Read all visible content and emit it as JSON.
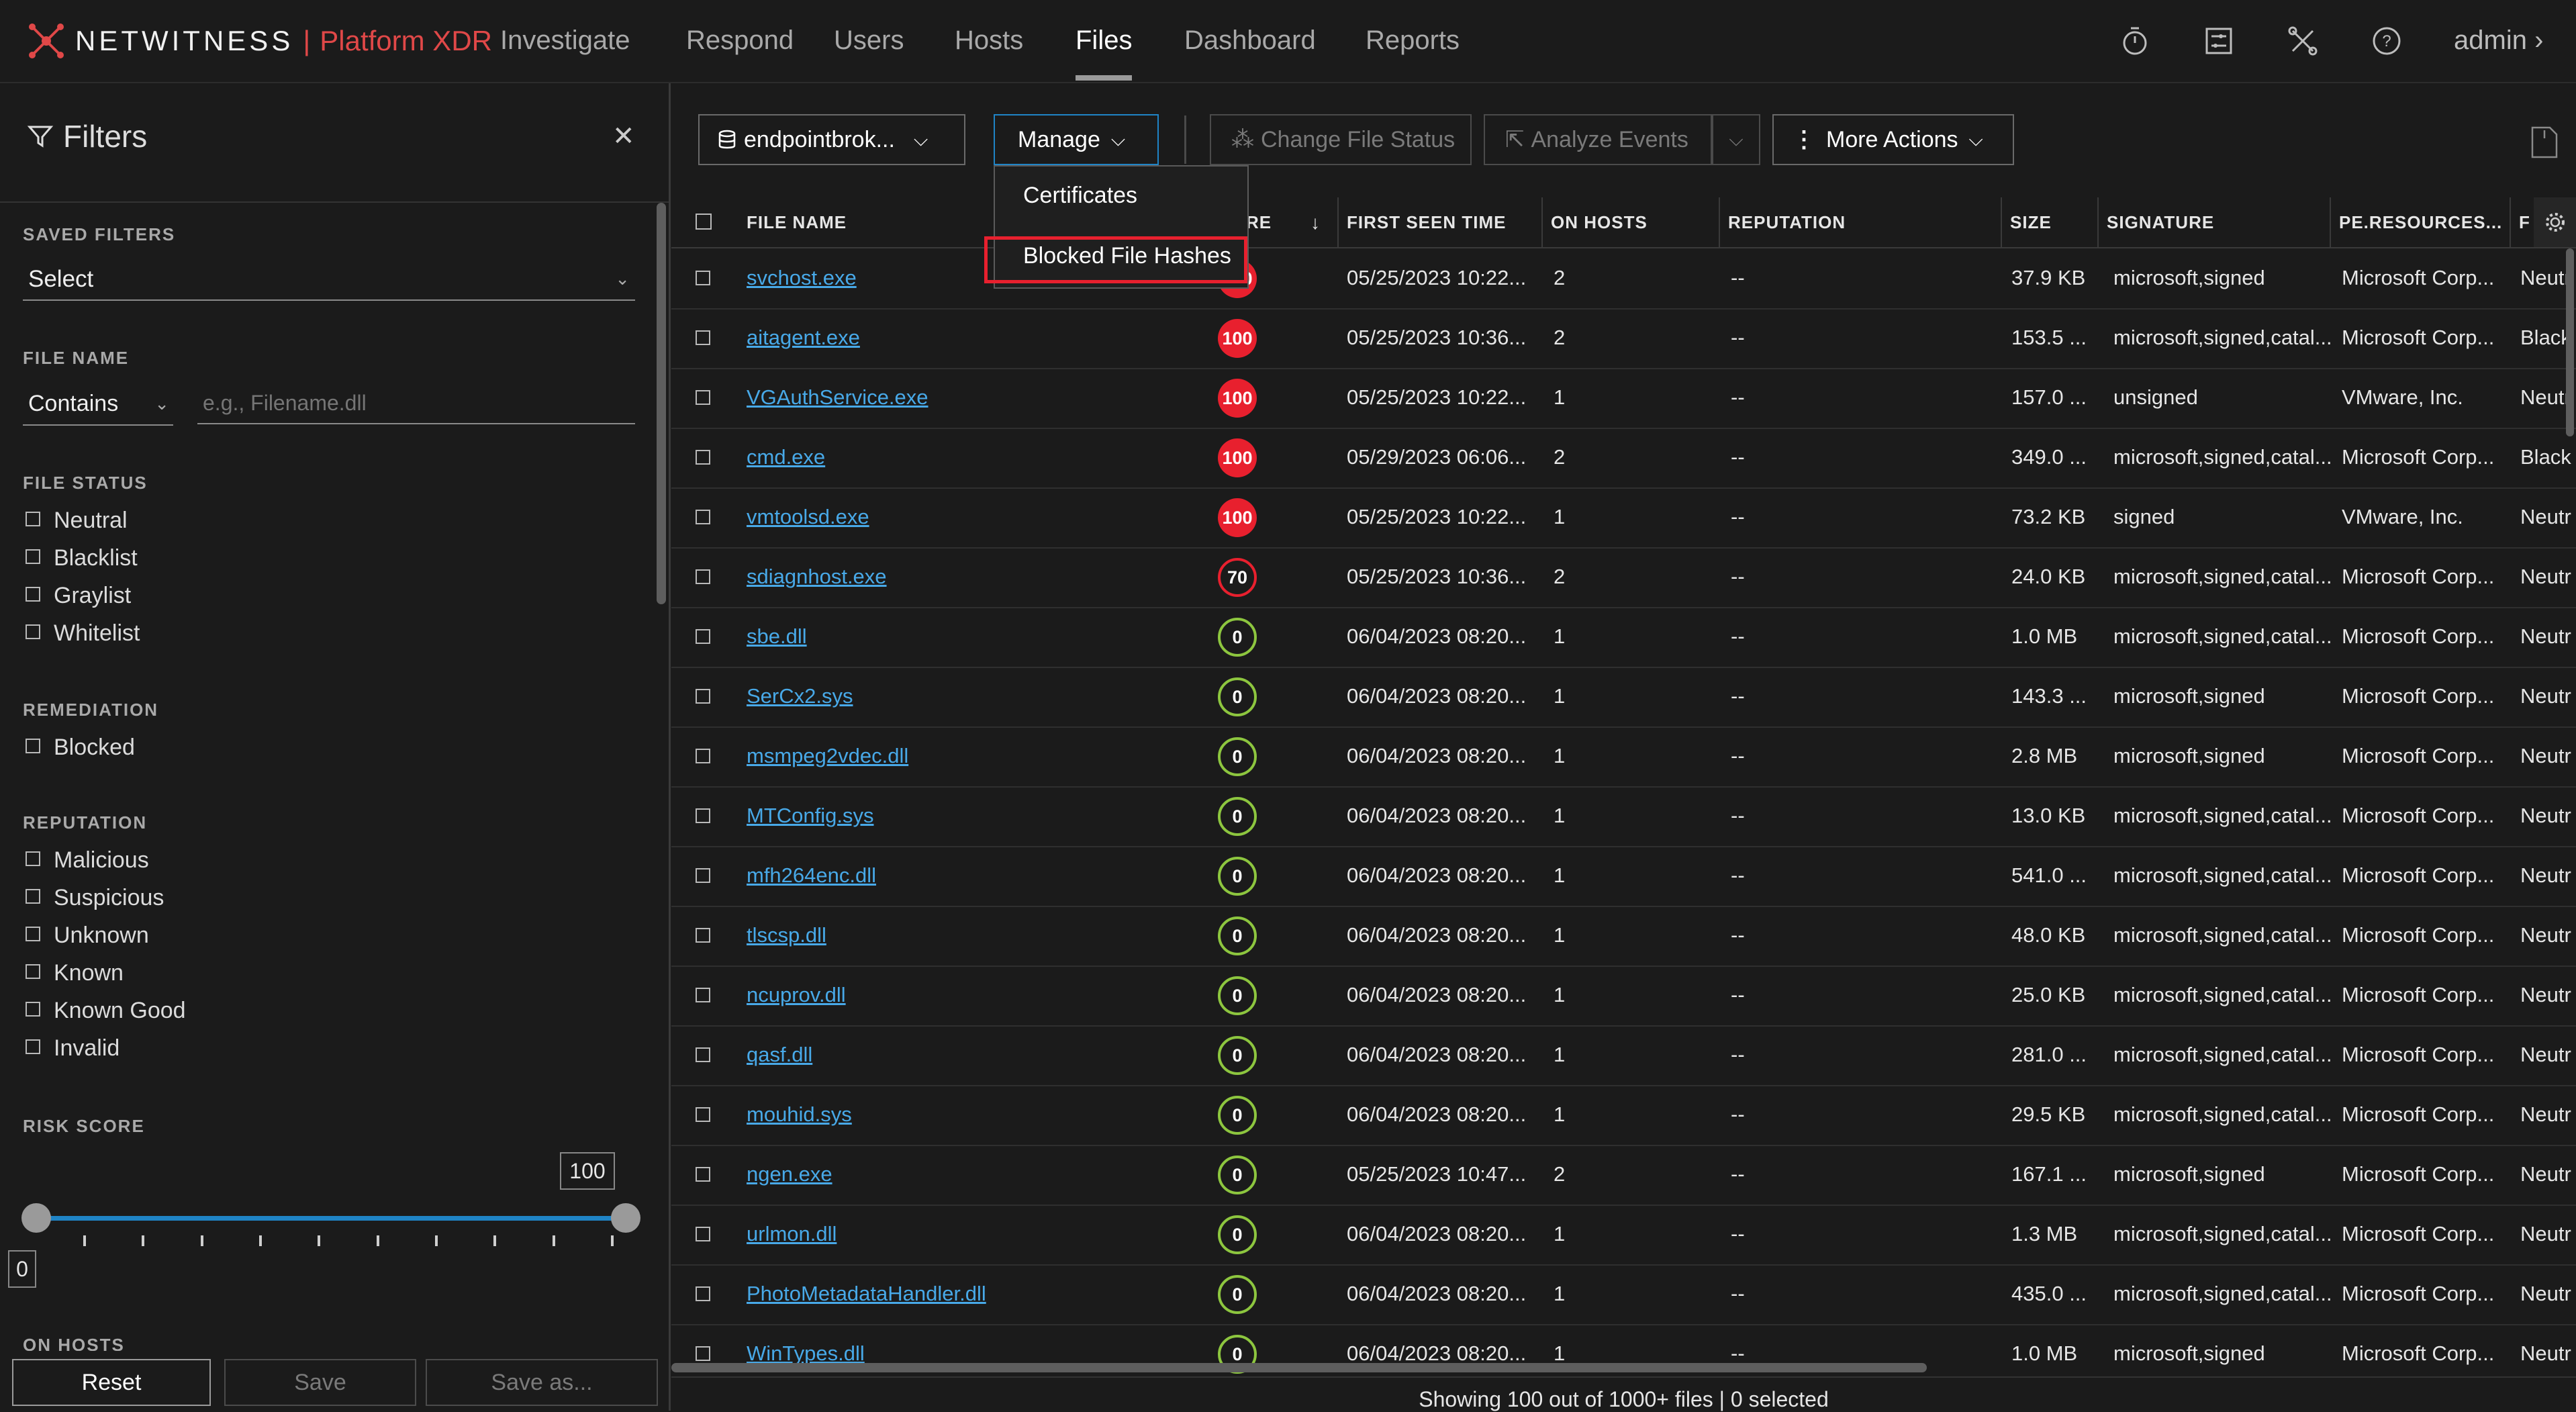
{
  "brand": {
    "name": "NETWITNESS",
    "separator": "|",
    "product": "Platform XDR"
  },
  "nav": {
    "items": [
      "Investigate",
      "Respond",
      "Users",
      "Hosts",
      "Files",
      "Dashboard",
      "Reports"
    ],
    "active": "Files",
    "user": "admin"
  },
  "filters": {
    "title": "Filters",
    "saved_filters": {
      "label": "SAVED FILTERS",
      "value": "Select"
    },
    "file_name": {
      "label": "FILE NAME",
      "operator": "Contains",
      "placeholder": "e.g., Filename.dll"
    },
    "file_status": {
      "label": "FILE STATUS",
      "options": [
        "Neutral",
        "Blacklist",
        "Graylist",
        "Whitelist"
      ]
    },
    "remediation": {
      "label": "REMEDIATION",
      "options": [
        "Blocked"
      ]
    },
    "reputation": {
      "label": "REPUTATION",
      "options": [
        "Malicious",
        "Suspicious",
        "Unknown",
        "Known",
        "Known Good",
        "Invalid"
      ]
    },
    "risk_score": {
      "label": "RISK SCORE",
      "min": "0",
      "max": "100"
    },
    "on_hosts_label": "ON HOSTS",
    "buttons": {
      "reset": "Reset",
      "save": "Save",
      "save_as": "Save as..."
    }
  },
  "toolbar": {
    "server": "endpointbrok...",
    "manage": "Manage",
    "change_status": "Change File Status",
    "analyze": "Analyze Events",
    "more_actions": "More Actions"
  },
  "manage_menu": {
    "items": [
      "Certificates",
      "Blocked File Hashes"
    ],
    "highlighted": "Blocked File Hashes"
  },
  "table": {
    "columns": [
      "FILE NAME",
      "RE",
      "FIRST SEEN TIME",
      "ON HOSTS",
      "REPUTATION",
      "SIZE",
      "SIGNATURE",
      "PE.RESOURCES...",
      "F"
    ],
    "rows": [
      {
        "name": "svchost.exe",
        "score": "100",
        "level": "high",
        "first_seen": "05/25/2023 10:22...",
        "hosts": "2",
        "reputation": "--",
        "size": "37.9 KB",
        "signature": "microsoft,signed",
        "pe": "Microsoft Corp...",
        "status": "Neutr"
      },
      {
        "name": "aitagent.exe",
        "score": "100",
        "level": "high",
        "first_seen": "05/25/2023 10:36...",
        "hosts": "2",
        "reputation": "--",
        "size": "153.5 ...",
        "signature": "microsoft,signed,catal...",
        "pe": "Microsoft Corp...",
        "status": "Black"
      },
      {
        "name": "VGAuthService.exe",
        "score": "100",
        "level": "high",
        "first_seen": "05/25/2023 10:22...",
        "hosts": "1",
        "reputation": "--",
        "size": "157.0 ...",
        "signature": "unsigned",
        "pe": "VMware, Inc.",
        "status": "Neutr"
      },
      {
        "name": "cmd.exe",
        "score": "100",
        "level": "high",
        "first_seen": "05/29/2023 06:06...",
        "hosts": "2",
        "reputation": "--",
        "size": "349.0 ...",
        "signature": "microsoft,signed,catal...",
        "pe": "Microsoft Corp...",
        "status": "Black"
      },
      {
        "name": "vmtoolsd.exe",
        "score": "100",
        "level": "high",
        "first_seen": "05/25/2023 10:22...",
        "hosts": "1",
        "reputation": "--",
        "size": "73.2 KB",
        "signature": "signed",
        "pe": "VMware, Inc.",
        "status": "Neutr"
      },
      {
        "name": "sdiagnhost.exe",
        "score": "70",
        "level": "med",
        "first_seen": "05/25/2023 10:36...",
        "hosts": "2",
        "reputation": "--",
        "size": "24.0 KB",
        "signature": "microsoft,signed,catal...",
        "pe": "Microsoft Corp...",
        "status": "Neutr"
      },
      {
        "name": "sbe.dll",
        "score": "0",
        "level": "low",
        "first_seen": "06/04/2023 08:20...",
        "hosts": "1",
        "reputation": "--",
        "size": "1.0 MB",
        "signature": "microsoft,signed,catal...",
        "pe": "Microsoft Corp...",
        "status": "Neutr"
      },
      {
        "name": "SerCx2.sys",
        "score": "0",
        "level": "low",
        "first_seen": "06/04/2023 08:20...",
        "hosts": "1",
        "reputation": "--",
        "size": "143.3 ...",
        "signature": "microsoft,signed",
        "pe": "Microsoft Corp...",
        "status": "Neutr"
      },
      {
        "name": "msmpeg2vdec.dll",
        "score": "0",
        "level": "low",
        "first_seen": "06/04/2023 08:20...",
        "hosts": "1",
        "reputation": "--",
        "size": "2.8 MB",
        "signature": "microsoft,signed",
        "pe": "Microsoft Corp...",
        "status": "Neutr"
      },
      {
        "name": "MTConfig.sys",
        "score": "0",
        "level": "low",
        "first_seen": "06/04/2023 08:20...",
        "hosts": "1",
        "reputation": "--",
        "size": "13.0 KB",
        "signature": "microsoft,signed,catal...",
        "pe": "Microsoft Corp...",
        "status": "Neutr"
      },
      {
        "name": "mfh264enc.dll",
        "score": "0",
        "level": "low",
        "first_seen": "06/04/2023 08:20...",
        "hosts": "1",
        "reputation": "--",
        "size": "541.0 ...",
        "signature": "microsoft,signed,catal...",
        "pe": "Microsoft Corp...",
        "status": "Neutr"
      },
      {
        "name": "tlscsp.dll",
        "score": "0",
        "level": "low",
        "first_seen": "06/04/2023 08:20...",
        "hosts": "1",
        "reputation": "--",
        "size": "48.0 KB",
        "signature": "microsoft,signed,catal...",
        "pe": "Microsoft Corp...",
        "status": "Neutr"
      },
      {
        "name": "ncuprov.dll",
        "score": "0",
        "level": "low",
        "first_seen": "06/04/2023 08:20...",
        "hosts": "1",
        "reputation": "--",
        "size": "25.0 KB",
        "signature": "microsoft,signed,catal...",
        "pe": "Microsoft Corp...",
        "status": "Neutr"
      },
      {
        "name": "qasf.dll",
        "score": "0",
        "level": "low",
        "first_seen": "06/04/2023 08:20...",
        "hosts": "1",
        "reputation": "--",
        "size": "281.0 ...",
        "signature": "microsoft,signed,catal...",
        "pe": "Microsoft Corp...",
        "status": "Neutr"
      },
      {
        "name": "mouhid.sys",
        "score": "0",
        "level": "low",
        "first_seen": "06/04/2023 08:20...",
        "hosts": "1",
        "reputation": "--",
        "size": "29.5 KB",
        "signature": "microsoft,signed,catal...",
        "pe": "Microsoft Corp...",
        "status": "Neutr"
      },
      {
        "name": "ngen.exe",
        "score": "0",
        "level": "low",
        "first_seen": "05/25/2023 10:47...",
        "hosts": "2",
        "reputation": "--",
        "size": "167.1 ...",
        "signature": "microsoft,signed",
        "pe": "Microsoft Corp...",
        "status": "Neutr"
      },
      {
        "name": "urlmon.dll",
        "score": "0",
        "level": "low",
        "first_seen": "06/04/2023 08:20...",
        "hosts": "1",
        "reputation": "--",
        "size": "1.3 MB",
        "signature": "microsoft,signed,catal...",
        "pe": "Microsoft Corp...",
        "status": "Neutr"
      },
      {
        "name": "PhotoMetadataHandler.dll",
        "score": "0",
        "level": "low",
        "first_seen": "06/04/2023 08:20...",
        "hosts": "1",
        "reputation": "--",
        "size": "435.0 ...",
        "signature": "microsoft,signed,catal...",
        "pe": "Microsoft Corp...",
        "status": "Neutr"
      },
      {
        "name": "WinTypes.dll",
        "score": "0",
        "level": "low",
        "first_seen": "06/04/2023 08:20...",
        "hosts": "1",
        "reputation": "--",
        "size": "1.0 MB",
        "signature": "microsoft,signed",
        "pe": "Microsoft Corp...",
        "status": "Neutr"
      }
    ]
  },
  "status": "Showing 100 out of 1000+ files | 0 selected",
  "colors": {
    "accent_red": "#e8202e",
    "link": "#48a9e8",
    "score_low": "#8dc63f",
    "slider": "#1f84c6"
  }
}
